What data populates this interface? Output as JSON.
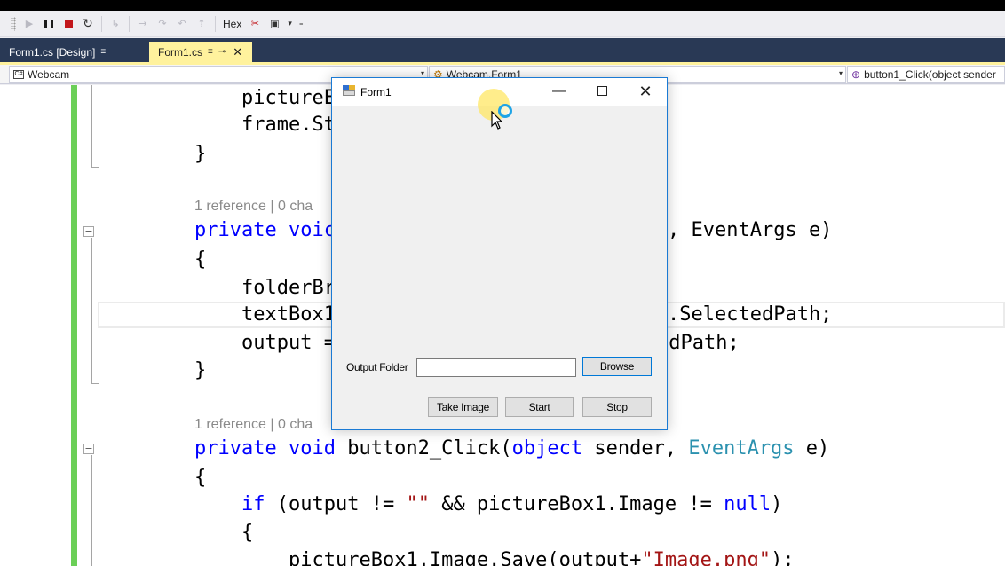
{
  "toolbar": {
    "hex_label": "Hex"
  },
  "tabs": [
    {
      "label": "Form1.cs [Design]",
      "pin": "≡",
      "active": false
    },
    {
      "label": "Form1.cs",
      "pin": "≡",
      "active": true
    }
  ],
  "nav": {
    "project": "Webcam",
    "class": "Webcam.Form1",
    "member": "button1_Click(object sender"
  },
  "code_lens": [
    "1 reference | 0 cha",
    "1 reference | 0 cha"
  ],
  "code": {
    "l1": "pictureE",
    "l2": "frame.St",
    "l3": "}",
    "l4a": "private",
    "l4b": "voic",
    "l4c": ", EventArgs e)",
    "l5": "{",
    "l6": "folderBr",
    "l7a": "textBox1",
    "l7b": ".SelectedPath;",
    "l8a": "output =",
    "l8b": "edPath;",
    "l9": "}",
    "l10_private": "private",
    "l10_void": "void",
    "l10_name": " button2_Click(",
    "l10_object": "object",
    "l10_sender": " sender, ",
    "l10_eventargs": "EventArgs",
    "l10_e": " e)",
    "l11": "{",
    "l12_if": "if",
    "l12_a": " (output != ",
    "l12_str": "\"\"",
    "l12_b": " && pictureBox1.Image != ",
    "l12_null": "null",
    "l12_c": ")",
    "l13": "{",
    "l14_a": "pictureBox1.Image.Save(output+",
    "l14_str": "\"Image.png\"",
    "l14_b": ");"
  },
  "form": {
    "title": "Form1",
    "output_folder_label": "Output Folder",
    "output_folder_value": "",
    "browse_label": "Browse",
    "take_image_label": "Take Image",
    "start_label": "Start",
    "stop_label": "Stop"
  },
  "colors": {
    "keyword": "#0000ff",
    "type": "#2b91af",
    "string": "#a31515",
    "active_tab": "#fff29d",
    "tab_strip": "#293955",
    "change_bar": "#6bcf57"
  }
}
